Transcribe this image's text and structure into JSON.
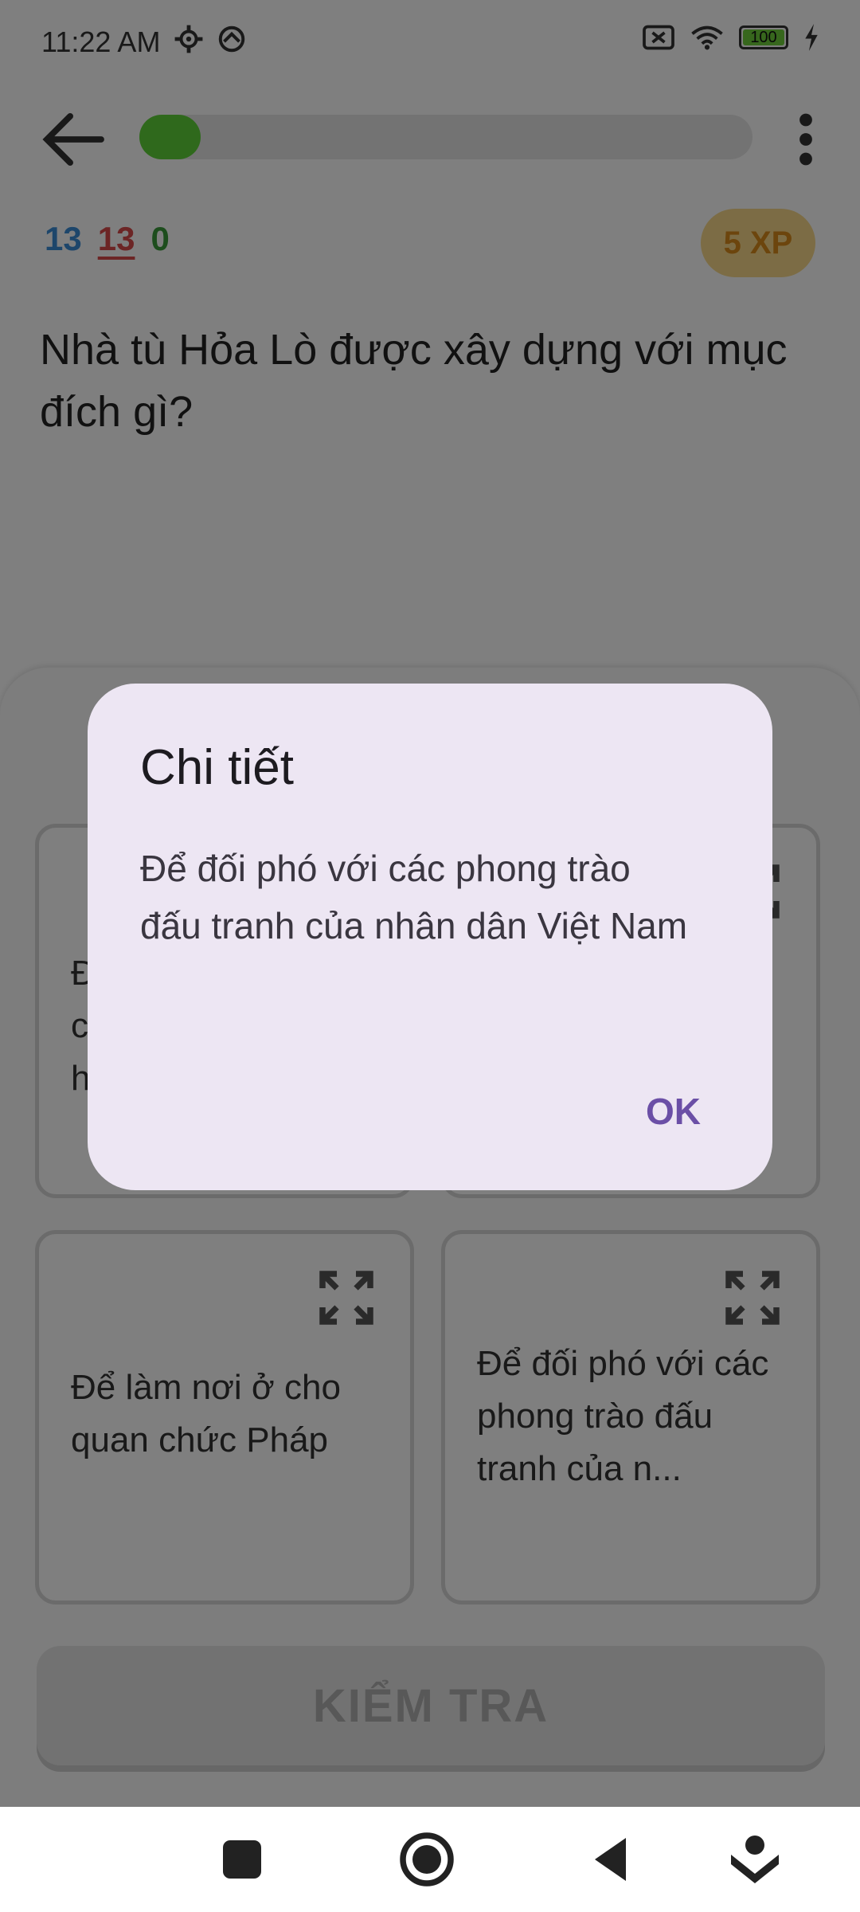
{
  "status_bar": {
    "time": "11:22 AM",
    "battery": "100"
  },
  "header": {
    "progress_fraction": 0.1
  },
  "stats": {
    "count_blue": "13",
    "count_red": "13",
    "count_green": "0",
    "xp": "5 XP"
  },
  "question": "Nhà tù Hỏa Lò được xây dựng với mục đích gì?",
  "answers": [
    {
      "text": "Đ\nc\nh"
    },
    {
      "text": ""
    },
    {
      "text": "Để làm nơi ở cho quan chức Pháp"
    },
    {
      "text": "Để đối phó với các phong trào đấu tranh của n..."
    }
  ],
  "check_button": "KIỂM TRA",
  "dialog": {
    "title": "Chi tiết",
    "body": "Để đối phó với các phong trào đấu tranh của nhân dân Việt Nam",
    "ok": "OK"
  },
  "colors": {
    "progress": "#5fd339",
    "dialog_bg": "#ede6f3",
    "dialog_ok": "#6b4fa6",
    "xp_badge": "#f8d98a"
  },
  "icons": [
    "gear-icon",
    "cast-icon",
    "close-box-icon",
    "wifi-icon",
    "battery-icon",
    "charging-icon",
    "back-arrow-icon",
    "more-vert-icon",
    "expand-icon",
    "stop-icon",
    "record-icon",
    "back-triangle-icon",
    "download-icon"
  ]
}
